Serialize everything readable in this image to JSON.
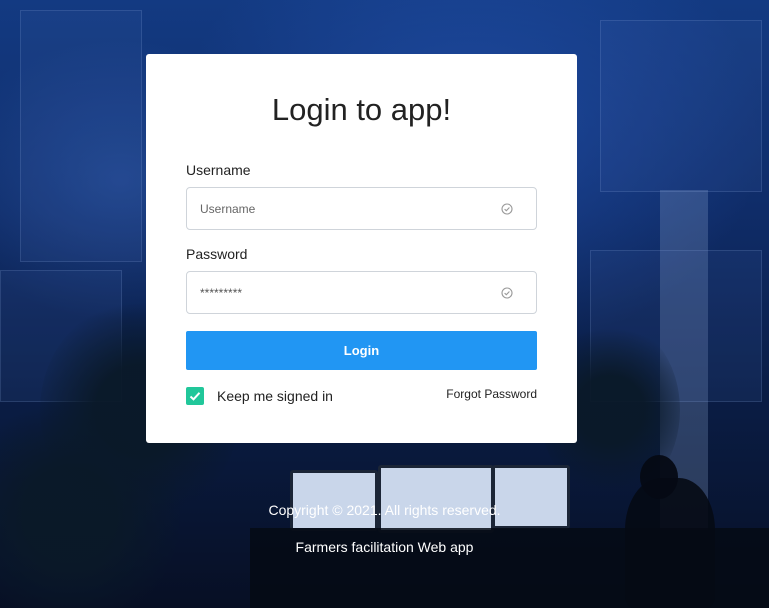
{
  "login_card": {
    "title": "Login to app!",
    "username": {
      "label": "Username",
      "placeholder": "Username",
      "icon": "check-circle-icon"
    },
    "password": {
      "label": "Password",
      "value": "*********",
      "icon": "check-circle-icon"
    },
    "login_button": "Login",
    "remember": {
      "label": "Keep me signed in",
      "checked": true
    },
    "forgot_link": "Forgot Password"
  },
  "footer": {
    "copyright": "Copyright © 2021. All rights reserved.",
    "app_name": "Farmers facilitation Web app"
  },
  "colors": {
    "primary": "#2196f3",
    "checkbox": "#21c79a",
    "background": "#0f2c68"
  }
}
